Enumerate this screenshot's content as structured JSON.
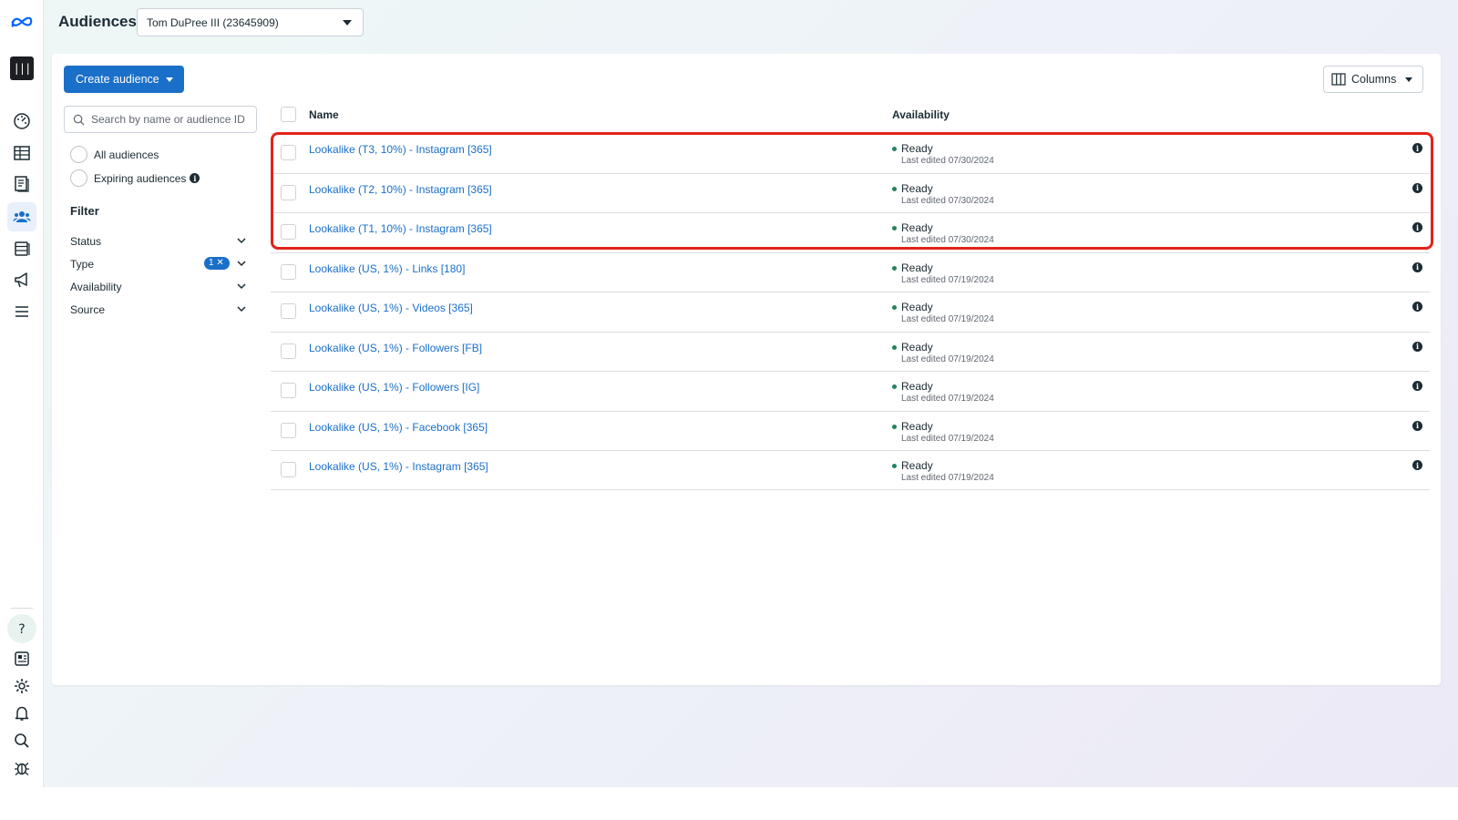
{
  "header": {
    "title": "Audiences",
    "account": "Tom DuPree III (23645909)"
  },
  "rail": {
    "brand_glyph": "|||",
    "icons": [
      "meta-logo-icon",
      "dashboard-icon",
      "table-icon",
      "catalog-icon",
      "audiences-icon",
      "database-icon",
      "campaigns-icon",
      "menu-icon",
      "help-icon",
      "pages-icon",
      "settings-icon",
      "notifications-icon",
      "search-icon",
      "bug-icon"
    ]
  },
  "toolbar": {
    "create_label": "Create audience",
    "columns_label": "Columns"
  },
  "search": {
    "placeholder": "Search by name or audience ID"
  },
  "scope": {
    "all_label": "All audiences",
    "expiring_label": "Expiring audiences"
  },
  "filter": {
    "title": "Filter",
    "status_label": "Status",
    "type_label": "Type",
    "type_badge": "1 ✕",
    "availability_label": "Availability",
    "source_label": "Source"
  },
  "table": {
    "col_name": "Name",
    "col_availability": "Availability",
    "rows": [
      {
        "name": "Lookalike (T3, 10%) - Instagram [365]",
        "status": "Ready",
        "edited": "Last edited 07/30/2024"
      },
      {
        "name": "Lookalike (T2, 10%) - Instagram [365]",
        "status": "Ready",
        "edited": "Last edited 07/30/2024"
      },
      {
        "name": "Lookalike (T1, 10%) - Instagram [365]",
        "status": "Ready",
        "edited": "Last edited 07/30/2024"
      },
      {
        "name": "Lookalike (US, 1%) - Links [180]",
        "status": "Ready",
        "edited": "Last edited 07/19/2024"
      },
      {
        "name": "Lookalike (US, 1%) - Videos [365]",
        "status": "Ready",
        "edited": "Last edited 07/19/2024"
      },
      {
        "name": "Lookalike (US, 1%) - Followers [FB]",
        "status": "Ready",
        "edited": "Last edited 07/19/2024"
      },
      {
        "name": "Lookalike (US, 1%) - Followers [IG]",
        "status": "Ready",
        "edited": "Last edited 07/19/2024"
      },
      {
        "name": "Lookalike (US, 1%) - Facebook [365]",
        "status": "Ready",
        "edited": "Last edited 07/19/2024"
      },
      {
        "name": "Lookalike (US, 1%) - Instagram [365]",
        "status": "Ready",
        "edited": "Last edited 07/19/2024"
      }
    ]
  },
  "colors": {
    "accent": "#1a6fc9",
    "ready": "#21845b",
    "highlight": "#e2231a"
  }
}
